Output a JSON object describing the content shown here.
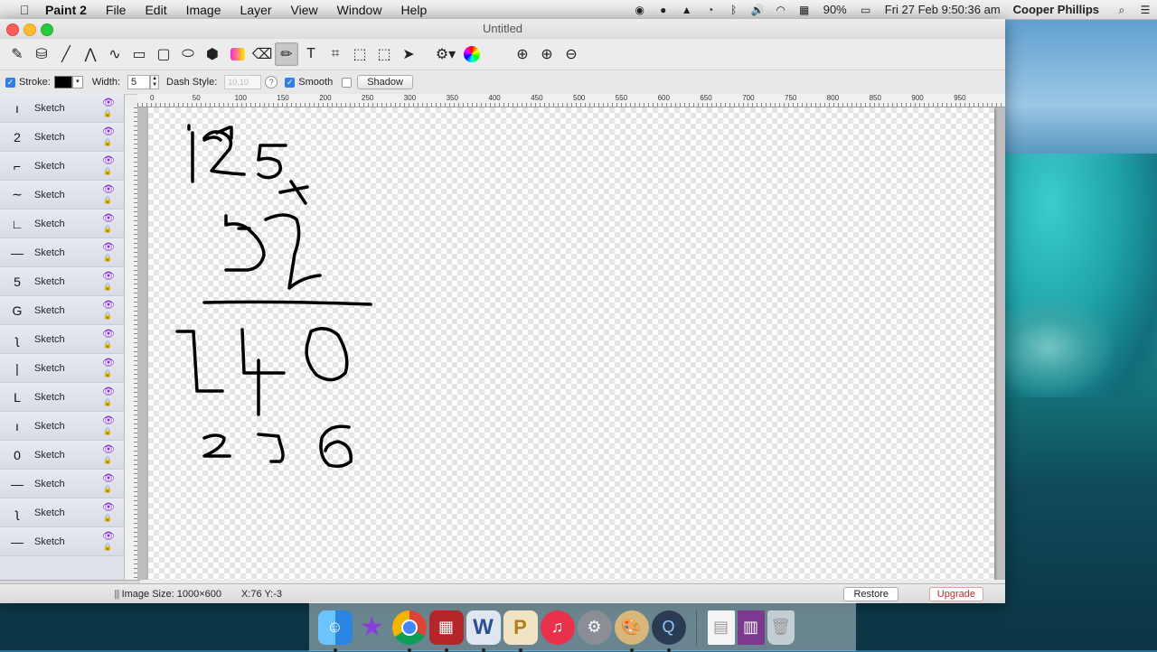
{
  "menubar": {
    "app_name": "Paint 2",
    "menus": [
      "File",
      "Edit",
      "Image",
      "Layer",
      "View",
      "Window",
      "Help"
    ],
    "battery": "90%",
    "clock": "Fri 27 Feb  9:50:36 am",
    "user": "Cooper Phillips"
  },
  "window": {
    "title": "Untitled"
  },
  "options": {
    "stroke_label": "Stroke:",
    "width_label": "Width:",
    "width_value": "5",
    "dash_label": "Dash Style:",
    "dash_value": "10,10",
    "smooth_label": "Smooth",
    "shadow_label": "Shadow",
    "stroke_color": "#000000"
  },
  "ruler": {
    "marks": [
      "0",
      "50",
      "100",
      "150",
      "200",
      "250",
      "300",
      "350",
      "400",
      "450",
      "500",
      "550",
      "600",
      "650",
      "700",
      "750",
      "800",
      "850",
      "900",
      "950"
    ]
  },
  "layers": {
    "items": [
      {
        "name": "Sketch",
        "glyph": "ı"
      },
      {
        "name": "Sketch",
        "glyph": "2"
      },
      {
        "name": "Sketch",
        "glyph": "⌐"
      },
      {
        "name": "Sketch",
        "glyph": "∼"
      },
      {
        "name": "Sketch",
        "glyph": "∟"
      },
      {
        "name": "Sketch",
        "glyph": "—"
      },
      {
        "name": "Sketch",
        "glyph": "5"
      },
      {
        "name": "Sketch",
        "glyph": "G"
      },
      {
        "name": "Sketch",
        "glyph": "ʅ"
      },
      {
        "name": "Sketch",
        "glyph": "|"
      },
      {
        "name": "Sketch",
        "glyph": "L"
      },
      {
        "name": "Sketch",
        "glyph": "ı"
      },
      {
        "name": "Sketch",
        "glyph": "0"
      },
      {
        "name": "Sketch",
        "glyph": "—"
      },
      {
        "name": "Sketch",
        "glyph": "ʅ"
      },
      {
        "name": "Sketch",
        "glyph": "—"
      }
    ]
  },
  "status": {
    "image_size": "Image Size: 1000×600",
    "cursor": "X:76 Y:-3",
    "restore": "Restore",
    "upgrade": "Upgrade"
  },
  "colors": {
    "accent_check": "#2f7fe5",
    "upgrade_red": "#c0262c",
    "eye_purple": "#8a2be2"
  }
}
